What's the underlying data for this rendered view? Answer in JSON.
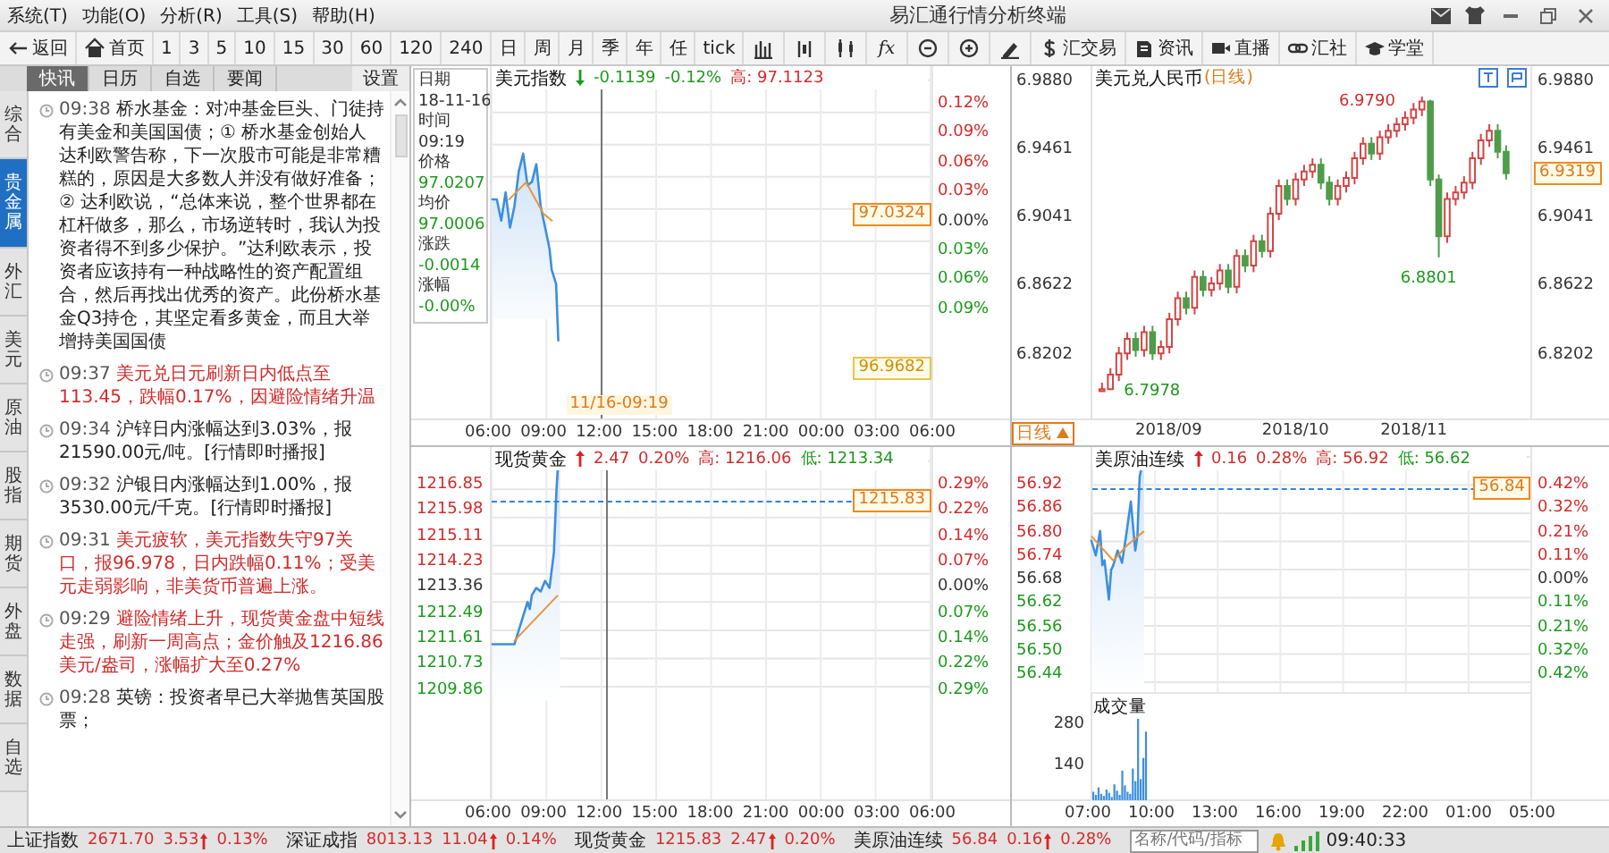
{
  "window": {
    "title": "易汇通行情分析终端",
    "menu": [
      "系统(T)",
      "功能(O)",
      "分析(R)",
      "工具(S)",
      "帮助(H)"
    ]
  },
  "toolbar": {
    "nav": [
      "返回",
      "首页"
    ],
    "periods": [
      "1",
      "3",
      "5",
      "10",
      "15",
      "30",
      "60",
      "120",
      "240",
      "日",
      "周",
      "月",
      "季",
      "年",
      "任",
      "tick"
    ],
    "function": "fx",
    "links": [
      "汇交易",
      "资讯",
      "直播",
      "汇社",
      "学堂"
    ]
  },
  "news": {
    "tabs": [
      {
        "label": "快讯",
        "selected": true
      },
      {
        "label": "日历",
        "selected": false
      },
      {
        "label": "自选",
        "selected": false
      },
      {
        "label": "要闻",
        "selected": false
      }
    ],
    "settings": "设置",
    "side_tabs": [
      {
        "label": "综合",
        "selected": false
      },
      {
        "label": "贵金属",
        "selected": true
      },
      {
        "label": "外汇",
        "selected": false
      },
      {
        "label": "美元",
        "selected": false
      },
      {
        "label": "原油",
        "selected": false
      },
      {
        "label": "股指",
        "selected": false
      },
      {
        "label": "期货",
        "selected": false
      },
      {
        "label": "外盘",
        "selected": false
      },
      {
        "label": "数据",
        "selected": false
      },
      {
        "label": "自选",
        "selected": false
      }
    ],
    "items": [
      {
        "time": "09:38",
        "text": "桥水基金：对冲基金巨头、门徒持有美金和美国国债；① 桥水基金创始人达利欧警告称，下一次股市可能是非常糟糕的，原因是大多数人并没有做好准备；② 达利欧说，“总体来说，整个世界都在杠杆做多，那么，市场逆转时，我认为投资者得不到多少保护。”达利欧表示，投资者应该持有一种战略性的资产配置组合，然后再找出优秀的资产。此份桥水基金Q3持仓，其坚定看多黄金，而且大举增持美国国债",
        "highlighted": false
      },
      {
        "time": "09:37",
        "text": "美元兑日元刷新日内低点至113.45，跌幅0.17%，因避险情绪升温",
        "highlighted": true
      },
      {
        "time": "09:34",
        "text": "沪锌日内涨幅达到3.03%，报21590.00元/吨。[行情即时播报]",
        "highlighted": false
      },
      {
        "time": "09:32",
        "text": "沪银日内涨幅达到1.00%，报3530.00元/千克。[行情即时播报]",
        "highlighted": false
      },
      {
        "time": "09:31",
        "text": "美元疲软，美元指数失守97关口，报96.978，日内跌幅0.11%；受美元走弱影响，非美货币普遍上涨。",
        "highlighted": true
      },
      {
        "time": "09:29",
        "text": "避险情绪上升，现货黄金盘中短线走强，刷新一周高点；金价触及1216.86美元/盎司，涨幅扩大至0.27%",
        "highlighted": true
      },
      {
        "time": "09:28",
        "text": "英镑：投资者早已大举抛售英国股票；",
        "highlighted": false
      }
    ]
  },
  "charts": [
    {
      "kind": "intraday",
      "title": "美元指数",
      "header": [
        {
          "text": "-0.1139",
          "kind": "down",
          "arrow": true
        },
        {
          "text": "-0.12%",
          "kind": "down"
        },
        {
          "text": "高: 97.1123",
          "kind": "up"
        }
      ],
      "tooltip": [
        {
          "label": "日期",
          "value": "18-11-16",
          "kind": "flat"
        },
        {
          "label": "时间",
          "value": "09:19",
          "kind": "flat"
        },
        {
          "label": "价格",
          "value": "97.0207",
          "kind": "down"
        },
        {
          "label": "均价",
          "value": "97.0006",
          "kind": "down"
        },
        {
          "label": "涨跌",
          "value": "-0.0014",
          "kind": "down"
        },
        {
          "label": "涨幅",
          "value": "-0.00%",
          "kind": "down"
        }
      ],
      "right_axis": [
        {
          "text": "0.12%",
          "kind": "up"
        },
        {
          "text": "0.09%",
          "kind": "up"
        },
        {
          "text": "0.06%",
          "kind": "up"
        },
        {
          "text": "0.03%",
          "kind": "up"
        },
        {
          "text": "0.00%",
          "kind": "flat"
        },
        {
          "text": "0.03%",
          "kind": "down"
        },
        {
          "text": "0.06%",
          "kind": "down"
        },
        {
          "text": "0.09%",
          "kind": "down"
        }
      ],
      "price_tags": [
        {
          "text": "97.0324",
          "kind": "current"
        },
        {
          "text": "96.9682",
          "kind": "low"
        }
      ],
      "cursor_label": "11/16-09:19",
      "x_axis": [
        "06:00",
        "09:00",
        "12:00",
        "15:00",
        "18:00",
        "21:00",
        "00:00",
        "03:00",
        "06:00"
      ]
    },
    {
      "kind": "candles",
      "period_note": "(日线)",
      "chart_data": {
        "type": "candlestick",
        "title": "美元兑人民币",
        "categories": [
          null,
          null,
          null,
          null,
          null,
          null,
          null,
          null,
          "2018/09",
          null,
          null,
          null,
          null,
          null,
          null,
          null,
          null,
          null,
          null,
          null,
          null,
          null,
          null,
          "2018/10",
          null,
          null,
          null,
          null,
          null,
          null,
          null,
          null,
          null,
          null,
          null,
          null,
          null,
          "2018/11",
          null,
          null,
          null,
          null,
          null,
          null,
          null,
          null,
          null,
          null,
          null
        ],
        "ohlc": [
          [
            6.798,
            6.803,
            6.7978,
            6.799
          ],
          [
            6.799,
            6.812,
            6.7985,
            6.808
          ],
          [
            6.808,
            6.825,
            6.804,
            6.821
          ],
          [
            6.821,
            6.834,
            6.817,
            6.83
          ],
          [
            6.83,
            6.834,
            6.819,
            6.823
          ],
          [
            6.823,
            6.838,
            6.819,
            6.834
          ],
          [
            6.834,
            6.838,
            6.817,
            6.821
          ],
          [
            6.821,
            6.829,
            6.817,
            6.825
          ],
          [
            6.825,
            6.846,
            6.821,
            6.842
          ],
          [
            6.842,
            6.859,
            6.838,
            6.855
          ],
          [
            6.855,
            6.859,
            6.845,
            6.849
          ],
          [
            6.849,
            6.872,
            6.845,
            6.868
          ],
          [
            6.868,
            6.872,
            6.856,
            6.86
          ],
          [
            6.86,
            6.868,
            6.856,
            6.864
          ],
          [
            6.864,
            6.876,
            6.86,
            6.872
          ],
          [
            6.872,
            6.876,
            6.858,
            6.862
          ],
          [
            6.862,
            6.885,
            6.858,
            6.881
          ],
          [
            6.881,
            6.885,
            6.871,
            6.875
          ],
          [
            6.875,
            6.894,
            6.871,
            6.89
          ],
          [
            6.89,
            6.894,
            6.88,
            6.884
          ],
          [
            6.884,
            6.911,
            6.88,
            6.907
          ],
          [
            6.907,
            6.928,
            6.903,
            6.924
          ],
          [
            6.924,
            6.928,
            6.912,
            6.916
          ],
          [
            6.916,
            6.932,
            6.912,
            6.928
          ],
          [
            6.928,
            6.937,
            6.924,
            6.933
          ],
          [
            6.933,
            6.941,
            6.929,
            6.937
          ],
          [
            6.937,
            6.941,
            6.922,
            6.926
          ],
          [
            6.926,
            6.93,
            6.912,
            6.916
          ],
          [
            6.916,
            6.928,
            6.912,
            6.924
          ],
          [
            6.924,
            6.933,
            6.92,
            6.929
          ],
          [
            6.929,
            6.945,
            6.925,
            6.941
          ],
          [
            6.941,
            6.954,
            6.937,
            6.95
          ],
          [
            6.95,
            6.954,
            6.94,
            6.944
          ],
          [
            6.944,
            6.958,
            6.94,
            6.954
          ],
          [
            6.954,
            6.962,
            6.95,
            6.958
          ],
          [
            6.958,
            6.966,
            6.954,
            6.962
          ],
          [
            6.962,
            6.97,
            6.958,
            6.966
          ],
          [
            6.966,
            6.975,
            6.962,
            6.971
          ],
          [
            6.971,
            6.979,
            6.967,
            6.976
          ],
          [
            6.976,
            6.977,
            6.924,
            6.928
          ],
          [
            6.928,
            6.931,
            6.8801,
            6.893
          ],
          [
            6.893,
            6.92,
            6.889,
            6.916
          ],
          [
            6.916,
            6.924,
            6.912,
            6.92
          ],
          [
            6.92,
            6.93,
            6.916,
            6.926
          ],
          [
            6.926,
            6.945,
            6.922,
            6.941
          ],
          [
            6.941,
            6.956,
            6.937,
            6.952
          ],
          [
            6.952,
            6.962,
            6.948,
            6.958
          ],
          [
            6.958,
            6.962,
            6.941,
            6.945
          ],
          [
            6.945,
            6.949,
            6.928,
            6.9319
          ]
        ],
        "ylim": [
          6.7813,
          6.998
        ],
        "yticks": [
          {
            "value": 6.8202,
            "label": "6.8202"
          },
          {
            "value": 6.8622,
            "label": "6.8622"
          },
          {
            "value": 6.9041,
            "label": "6.9041"
          },
          {
            "value": 6.9461,
            "label": "6.9461"
          },
          {
            "value": 6.988,
            "label": "6.9880"
          }
        ]
      },
      "right_axis": [
        "6.9880",
        "6.9461",
        "6.9041",
        "6.8622",
        "6.8202"
      ],
      "price_tags": [
        {
          "text": "6.9319",
          "kind": "current"
        }
      ],
      "markers": [
        {
          "text": "6.9790",
          "kind": "up"
        },
        {
          "text": "6.8801",
          "kind": "down"
        },
        {
          "text": "6.7978",
          "kind": "down"
        }
      ],
      "period": "日线"
    },
    {
      "kind": "intraday",
      "title": "现货黄金",
      "header": [
        {
          "text": "2.47",
          "kind": "up",
          "arrow": true
        },
        {
          "text": "0.20%",
          "kind": "up"
        },
        {
          "text": "高: 1216.06",
          "kind": "up"
        },
        {
          "text": "低: 1213.34",
          "kind": "down"
        }
      ],
      "left_axis": [
        {
          "text": "1216.85",
          "kind": "up"
        },
        {
          "text": "1215.98",
          "kind": "up"
        },
        {
          "text": "1215.11",
          "kind": "up"
        },
        {
          "text": "1214.23",
          "kind": "up"
        },
        {
          "text": "1213.36",
          "kind": "flat"
        },
        {
          "text": "1212.49",
          "kind": "down"
        },
        {
          "text": "1211.61",
          "kind": "down"
        },
        {
          "text": "1210.73",
          "kind": "down"
        },
        {
          "text": "1209.86",
          "kind": "down"
        }
      ],
      "right_axis": [
        {
          "text": "0.29%",
          "kind": "up"
        },
        {
          "text": "0.22%",
          "kind": "up"
        },
        {
          "text": "0.14%",
          "kind": "up"
        },
        {
          "text": "0.07%",
          "kind": "up"
        },
        {
          "text": "0.00%",
          "kind": "flat"
        },
        {
          "text": "0.07%",
          "kind": "down"
        },
        {
          "text": "0.14%",
          "kind": "down"
        },
        {
          "text": "0.22%",
          "kind": "down"
        },
        {
          "text": "0.29%",
          "kind": "down"
        }
      ],
      "price_tags": [
        {
          "text": "1215.83",
          "kind": "current"
        }
      ],
      "x_axis": [
        "06:00",
        "09:00",
        "12:00",
        "15:00",
        "18:00",
        "21:00",
        "00:00",
        "03:00",
        "06:00"
      ]
    },
    {
      "kind": "intraday",
      "title": "美原油连续",
      "header": [
        {
          "text": "0.16",
          "kind": "up",
          "arrow": true
        },
        {
          "text": "0.28%",
          "kind": "up"
        },
        {
          "text": "高: 56.92",
          "kind": "up"
        },
        {
          "text": "低: 56.62",
          "kind": "down"
        }
      ],
      "left_axis": [
        {
          "text": "56.92",
          "kind": "up"
        },
        {
          "text": "56.86",
          "kind": "up"
        },
        {
          "text": "56.80",
          "kind": "up"
        },
        {
          "text": "56.74",
          "kind": "up"
        },
        {
          "text": "56.68",
          "kind": "flat"
        },
        {
          "text": "56.62",
          "kind": "down"
        },
        {
          "text": "56.56",
          "kind": "down"
        },
        {
          "text": "56.50",
          "kind": "down"
        },
        {
          "text": "56.44",
          "kind": "down"
        }
      ],
      "right_axis": [
        {
          "text": "0.42%",
          "kind": "up"
        },
        {
          "text": "0.32%",
          "kind": "up"
        },
        {
          "text": "0.21%",
          "kind": "up"
        },
        {
          "text": "0.11%",
          "kind": "up"
        },
        {
          "text": "0.00%",
          "kind": "flat"
        },
        {
          "text": "0.11%",
          "kind": "down"
        },
        {
          "text": "0.21%",
          "kind": "down"
        },
        {
          "text": "0.32%",
          "kind": "down"
        },
        {
          "text": "0.42%",
          "kind": "down"
        }
      ],
      "price_tags": [
        {
          "text": "56.84",
          "kind": "current"
        }
      ],
      "volume": {
        "title": "成交量",
        "axis": [
          "280",
          "140"
        ]
      },
      "x_axis": [
        "07:00",
        "10:00",
        "13:00",
        "16:00",
        "19:00",
        "22:00",
        "01:00",
        "05:00"
      ]
    }
  ],
  "status_bar": {
    "quotes": [
      {
        "name": "上证指数",
        "price": "2671.70",
        "change": "3.53",
        "percent": "0.13%",
        "kind": "up"
      },
      {
        "name": "深证成指",
        "price": "8013.13",
        "change": "11.04",
        "percent": "0.14%",
        "kind": "up"
      },
      {
        "name": "现货黄金",
        "price": "1215.83",
        "change": "2.47",
        "percent": "0.20%",
        "kind": "up"
      },
      {
        "name": "美原油连续",
        "price": "56.84",
        "change": "0.16",
        "percent": "0.28%",
        "kind": "up"
      }
    ],
    "search": {
      "placeholder": "名称/代码/指标"
    },
    "time": "09:40:33"
  }
}
